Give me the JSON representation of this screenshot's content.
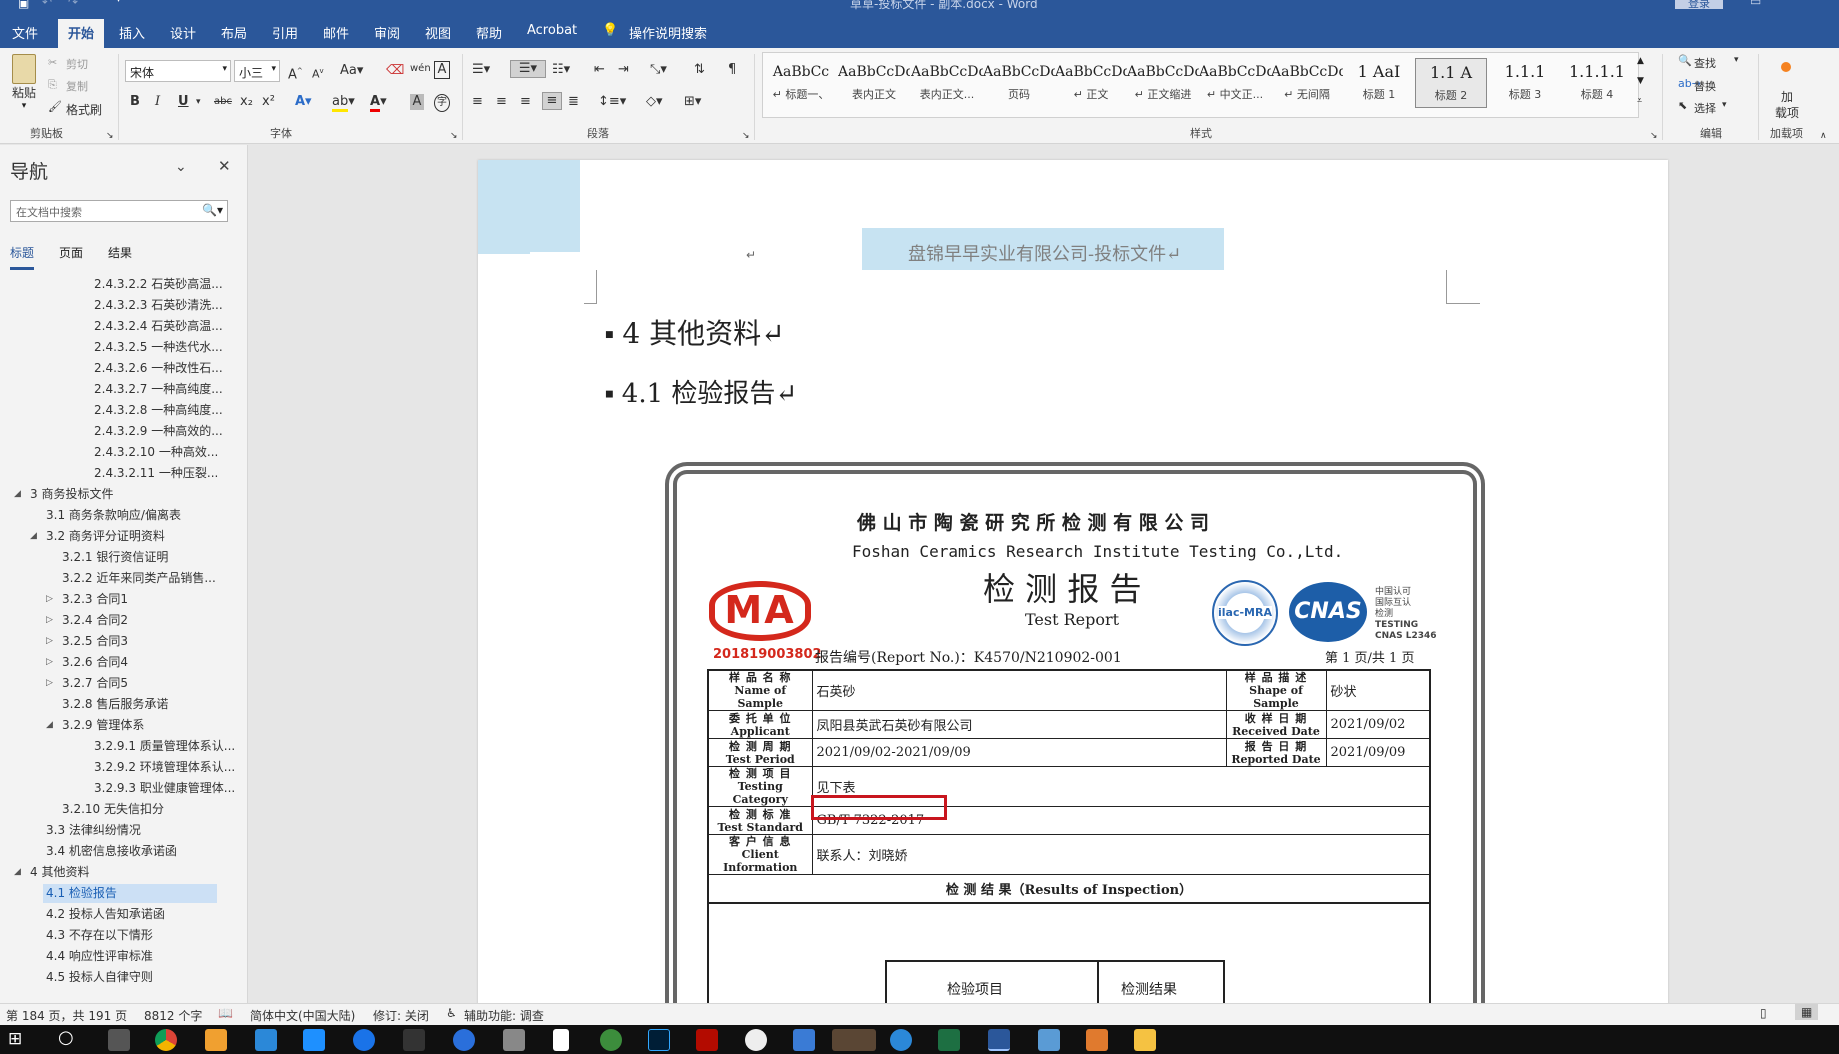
{
  "app": {
    "title_fragment": "草草-投标文件 - 副本.docx - Word",
    "signin": "登录"
  },
  "tabs": [
    "文件",
    "开始",
    "插入",
    "设计",
    "布局",
    "引用",
    "邮件",
    "审阅",
    "视图",
    "帮助",
    "Acrobat",
    "操作说明搜索"
  ],
  "active_tab": "开始",
  "ribbon": {
    "clipboard": {
      "paste": "粘贴",
      "cut": "剪切",
      "copy": "复制",
      "painter": "格式刷",
      "group": "剪贴板"
    },
    "font": {
      "name": "宋体",
      "size": "小三",
      "group": "字体",
      "bold": "B",
      "italic": "I",
      "underline": "U",
      "strike": "abc",
      "sub": "x₂",
      "sup": "x²"
    },
    "paragraph": {
      "group": "段落"
    },
    "styles": {
      "group": "样式",
      "items": [
        {
          "preview": "AaBbCc",
          "label": "↵ 标题一、"
        },
        {
          "preview": "AaBbCcDdI",
          "label": "表内正文"
        },
        {
          "preview": "AaBbCcDdI",
          "label": "表内正文..."
        },
        {
          "preview": "AaBbCcDd",
          "label": "页码"
        },
        {
          "preview": "AaBbCcDd",
          "label": "↵ 正文"
        },
        {
          "preview": "AaBbCcDdI",
          "label": "↵ 正文缩进"
        },
        {
          "preview": "AaBbCcDd",
          "label": "↵ 中文正..."
        },
        {
          "preview": "AaBbCcDd",
          "label": "↵ 无间隔"
        },
        {
          "preview": "1  AaI",
          "label": "标题 1"
        },
        {
          "preview": "1.1  A",
          "label": "标题 2"
        },
        {
          "preview": "1.1.1",
          "label": "标题 3"
        },
        {
          "preview": "1.1.1.1",
          "label": "标题 4"
        }
      ]
    },
    "editing": {
      "find": "查找",
      "replace": "替换",
      "select": "选择",
      "group": "编辑"
    },
    "addins": {
      "label1": "加",
      "label2": "载项",
      "group": "加载项"
    }
  },
  "nav": {
    "title": "导航",
    "search_placeholder": "在文档中搜索",
    "tabs": [
      "标题",
      "页面",
      "结果"
    ],
    "items": [
      {
        "level": 3,
        "text": "2.4.3.2.2 石英砂高温..."
      },
      {
        "level": 3,
        "text": "2.4.3.2.3 石英砂清洗..."
      },
      {
        "level": 3,
        "text": "2.4.3.2.4 石英砂高温..."
      },
      {
        "level": 3,
        "text": "2.4.3.2.5 一种迭代水..."
      },
      {
        "level": 3,
        "text": "2.4.3.2.6 一种改性石..."
      },
      {
        "level": 3,
        "text": "2.4.3.2.7 一种高纯度..."
      },
      {
        "level": 3,
        "text": "2.4.3.2.8 一种高纯度..."
      },
      {
        "level": 3,
        "text": "2.4.3.2.9 一种高效的..."
      },
      {
        "level": 3,
        "text": "2.4.3.2.10 一种高效..."
      },
      {
        "level": 3,
        "text": "2.4.3.2.11 一种压裂..."
      },
      {
        "level": 0,
        "text": "3 商务投标文件",
        "tri": "open"
      },
      {
        "level": 1,
        "text": "3.1 商务条款响应/偏离表"
      },
      {
        "level": 1,
        "text": "3.2 商务评分证明资料",
        "tri": "open"
      },
      {
        "level": 2,
        "text": "3.2.1 银行资信证明"
      },
      {
        "level": 2,
        "text": "3.2.2 近年来同类产品销售..."
      },
      {
        "level": 2,
        "text": "3.2.3 合同1",
        "tri": "closed"
      },
      {
        "level": 2,
        "text": "3.2.4 合同2",
        "tri": "closed"
      },
      {
        "level": 2,
        "text": "3.2.5 合同3",
        "tri": "closed"
      },
      {
        "level": 2,
        "text": "3.2.6 合同4",
        "tri": "closed"
      },
      {
        "level": 2,
        "text": "3.2.7 合同5",
        "tri": "closed"
      },
      {
        "level": 2,
        "text": "3.2.8 售后服务承诺"
      },
      {
        "level": 2,
        "text": "3.2.9 管理体系",
        "tri": "open"
      },
      {
        "level": 3,
        "text": "3.2.9.1 质量管理体系认..."
      },
      {
        "level": 3,
        "text": "3.2.9.2 环境管理体系认..."
      },
      {
        "level": 3,
        "text": "3.2.9.3 职业健康管理体..."
      },
      {
        "level": 2,
        "text": "3.2.10 无失信扣分"
      },
      {
        "level": 1,
        "text": "3.3 法律纠纷情况"
      },
      {
        "level": 1,
        "text": "3.4 机密信息接收承诺函"
      },
      {
        "level": 0,
        "text": "4 其他资料",
        "tri": "open"
      },
      {
        "level": 1,
        "text": "4.1 检验报告",
        "selected": true
      },
      {
        "level": 1,
        "text": "4.2 投标人告知承诺函"
      },
      {
        "level": 1,
        "text": "4.3 不存在以下情形"
      },
      {
        "level": 1,
        "text": "4.4 响应性评审标准"
      },
      {
        "level": 1,
        "text": "4.5 投标人自律守则"
      }
    ]
  },
  "doc": {
    "header": "盘锦早早实业有限公司-投标文件↵",
    "return_mark": "↵",
    "h1": "4   其他资料↵",
    "h2": "4.1    检验报告↵",
    "cert": {
      "company_cn": "佛 山 市 陶 瓷 研 究 所 检 测 有 限 公 司",
      "company_en": "Foshan Ceramics Research Institute Testing Co.,Ltd.",
      "title_cn": "检 测 报 告",
      "title_en": "Test  Report",
      "cma_text": "MA",
      "cma_no": "201819003802",
      "ilac": "ilac-MRA",
      "cnas": "CNAS",
      "cnas_note1": "中国认可",
      "cnas_note2": "国际互认",
      "cnas_note3": "检测",
      "cnas_note4": "TESTING",
      "cnas_note5": "CNAS L2346",
      "report_no": "报告编号(Report No.)：K4570/N210902-001",
      "page_info": "第 1 页/共 1 页",
      "rows": [
        {
          "l1": "样 品 名 称",
          "l2": "Name of Sample",
          "v": "石英砂",
          "r1": "样 品 描 述",
          "r2": "Shape of  Sample",
          "rv": "砂状"
        },
        {
          "l1": "委 托 单 位",
          "l2": "Applicant",
          "v": "凤阳县英武石英砂有限公司",
          "r1": "收 样 日 期",
          "r2": "Received  Date",
          "rv": "2021/09/02"
        },
        {
          "l1": "检 测 周 期",
          "l2": "Test Period",
          "v": "2021/09/02-2021/09/09",
          "r1": "报 告 日 期",
          "r2": "Reported  Date",
          "rv": "2021/09/09"
        },
        {
          "l1": "检 测 项 目",
          "l2": "Testing Category",
          "v": "见下表"
        },
        {
          "l1": "检 测 标 准",
          "l2": "Test  Standard",
          "v": "GB/T 7322-2017"
        },
        {
          "l1": "客 户 信 息",
          "l2": "Client Information",
          "v": "联系人：刘晓娇"
        }
      ],
      "results_title": "检  测  结  果（Results of Inspection）",
      "col_item": "检验项目",
      "col_result": "检测结果"
    }
  },
  "status": {
    "page": "第 184 页，共 191 页",
    "words": "8812 个字",
    "lang": "简体中文(中国大陆)",
    "track": "修订: 关闭",
    "access": "辅助功能: 调查"
  },
  "colors": {
    "ribbon_blue": "#2b579a",
    "cma_red": "#d4281c",
    "cnas_blue": "#1d5ea8",
    "highlight": "#c7e3f2",
    "box_red": "#c8161e"
  }
}
